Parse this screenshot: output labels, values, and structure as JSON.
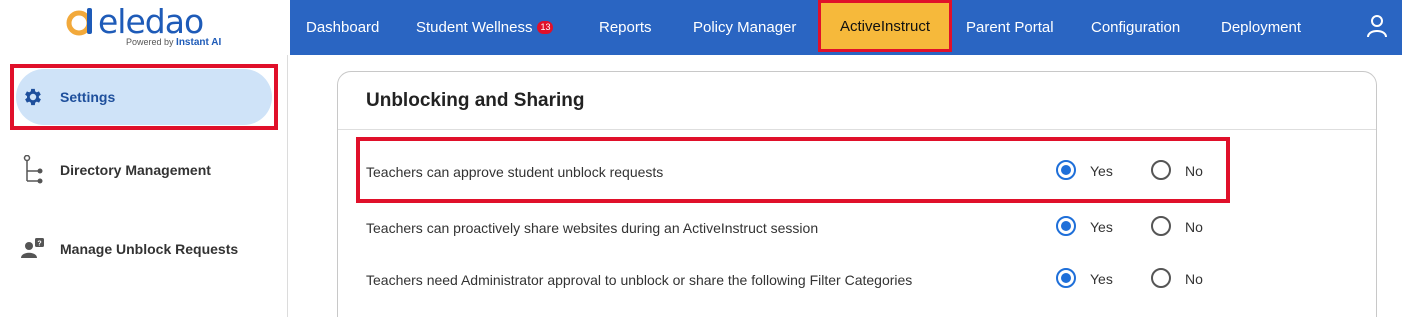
{
  "logo": {
    "name": "eledao",
    "powered_by": "Powered by",
    "partner": "Instant AI",
    "colors": {
      "brand_blue": "#1e5bb8",
      "brand_orange": "#f2a93b"
    }
  },
  "topnav": {
    "items": [
      {
        "label": "Dashboard"
      },
      {
        "label": "Student Wellness",
        "badge": "13"
      },
      {
        "label": "Reports"
      },
      {
        "label": "Policy Manager"
      },
      {
        "label": "ActiveInstruct",
        "active": true
      },
      {
        "label": "Parent Portal"
      },
      {
        "label": "Configuration"
      },
      {
        "label": "Deployment"
      }
    ],
    "user_icon": "user-icon",
    "background": "#2a65c2",
    "active_background": "#f6b93b"
  },
  "sidebar": {
    "items": [
      {
        "label": "Settings",
        "icon": "gear-icon",
        "active": true
      },
      {
        "label": "Directory Management",
        "icon": "tree-icon"
      },
      {
        "label": "Manage Unblock Requests",
        "icon": "user-question-icon"
      }
    ]
  },
  "main": {
    "card_title": "Unblocking and Sharing",
    "rows": [
      {
        "label": "Teachers can approve student unblock requests",
        "options": [
          "Yes",
          "No"
        ],
        "selected": "Yes"
      },
      {
        "label": "Teachers can proactively share websites during an ActiveInstruct session",
        "options": [
          "Yes",
          "No"
        ],
        "selected": "Yes"
      },
      {
        "label": "Teachers need Administrator approval to unblock or share the following Filter Categories",
        "options": [
          "Yes",
          "No"
        ],
        "selected": "Yes"
      }
    ]
  },
  "highlight_color": "#e0102a"
}
